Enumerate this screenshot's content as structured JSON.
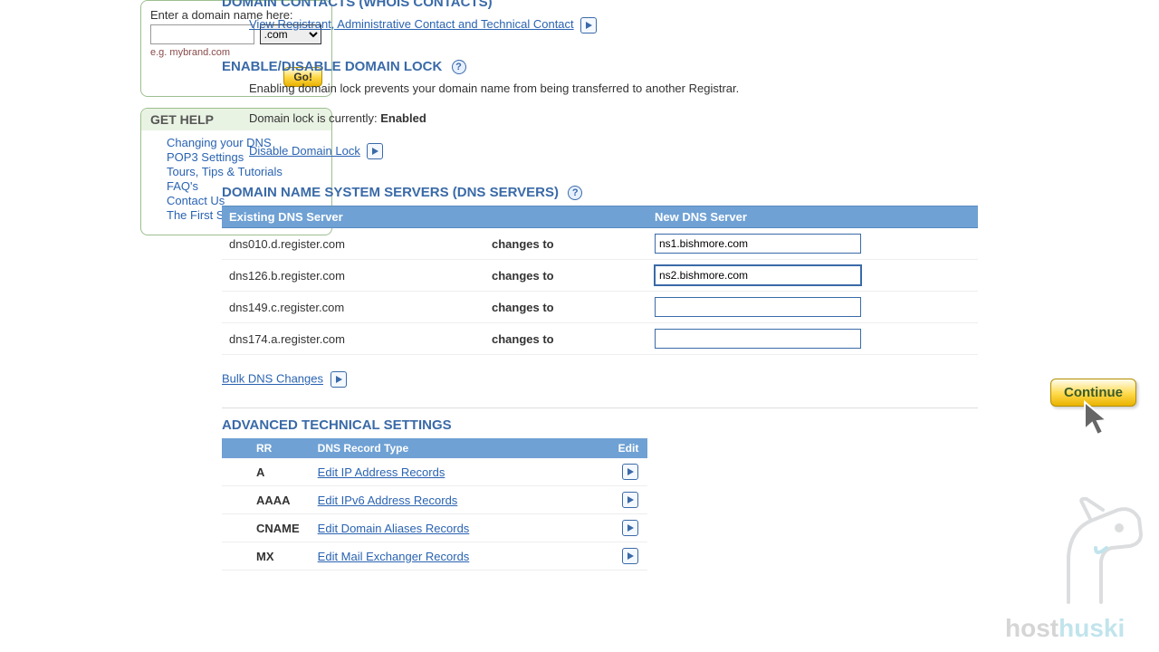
{
  "sidebar": {
    "domain_box": {
      "label": "Enter a domain name here:",
      "tld": ".com",
      "example": "e.g. mybrand.com",
      "go": "Go!"
    },
    "help": {
      "heading": "GET HELP",
      "links": [
        "Changing your DNS",
        "POP3 Settings",
        "Tours, Tips & Tutorials",
        "FAQ's",
        "Contact Us",
        "The First Step Guide"
      ]
    }
  },
  "sections": {
    "contacts": {
      "heading": "DOMAIN CONTACTS (WHOIS CONTACTS)",
      "link": "View Registrant, Administrative Contact and Technical Contact"
    },
    "lock": {
      "heading": "ENABLE/DISABLE DOMAIN LOCK",
      "desc": "Enabling domain lock prevents your domain name from being transferred to another Registrar.",
      "status_prefix": "Domain lock is currently: ",
      "status_value": "Enabled",
      "disable_link": "Disable Domain Lock"
    },
    "dns": {
      "heading": "DOMAIN NAME SYSTEM SERVERS (DNS SERVERS)",
      "col_existing": "Existing DNS Server",
      "col_new": "New DNS Server",
      "changes_to": "changes to",
      "rows": [
        {
          "existing": "dns010.d.register.com",
          "new_val": "ns1.bishmore.com"
        },
        {
          "existing": "dns126.b.register.com",
          "new_val": "ns2.bishmore.com"
        },
        {
          "existing": "dns149.c.register.com",
          "new_val": ""
        },
        {
          "existing": "dns174.a.register.com",
          "new_val": ""
        }
      ],
      "bulk_link": "Bulk DNS Changes",
      "continue": "Continue"
    },
    "advanced": {
      "heading": "ADVANCED TECHNICAL SETTINGS",
      "col_rr": "RR",
      "col_type": "DNS Record Type",
      "col_edit": "Edit",
      "rows": [
        {
          "rr": "A",
          "label": "Edit IP Address Records"
        },
        {
          "rr": "AAAA",
          "label": "Edit IPv6 Address Records"
        },
        {
          "rr": "CNAME",
          "label": "Edit Domain Aliases Records"
        },
        {
          "rr": "MX",
          "label": "Edit Mail Exchanger Records"
        }
      ]
    }
  },
  "watermark": {
    "brand1": "host",
    "brand2": "huski"
  }
}
